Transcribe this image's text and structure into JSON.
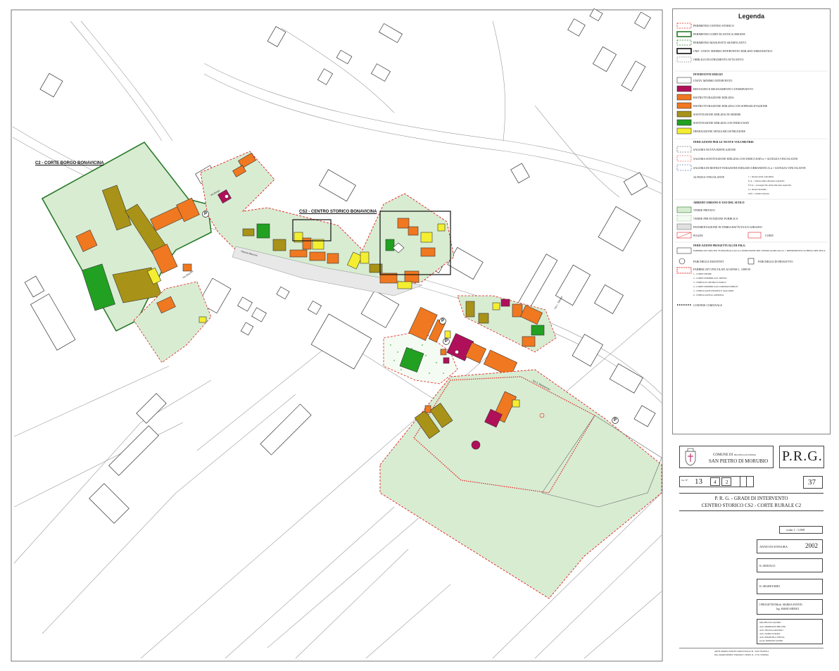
{
  "map": {
    "labels": {
      "c2": "C2 - CORTE BORGO BONAVICINA",
      "cs2": "CS2 - CENTRO STORICO BONAVICINA"
    },
    "streets": [
      "Via Borgo",
      "Piazza Marconi",
      "Via Mazzini",
      "Via S. Bartolomeo",
      "Via L. Stefani"
    ],
    "parking_symbol": "P",
    "colors": {
      "verde_privato": "#d8ecd2",
      "restauro": "#b0105a",
      "ristrutturazione": "#f07820",
      "sostituzione_sedime": "#a89218",
      "sostituzione_dati": "#22a022",
      "demolizione": "#f4ee30",
      "perimetro": "#e02020",
      "corti": "#2a7a2a",
      "piazze": "#e8e8e8"
    }
  },
  "legend": {
    "title": "Legenda",
    "perimeters": [
      "PERIMETRO CENTRO STORICO",
      "PERIMETRO CORTI DI ANTICA ORIGINE",
      "PERIMETRO MANUFATTI SIGNIFICATIVI",
      "UMI - UNITA' MINIMO INTERVENTO EDILIZIO URBANISTICO",
      "OBBLIGO DI STRUMENTO ATTUATIVO"
    ],
    "interventi_title": "INTERVENTI EDILIZI",
    "interventi": [
      "UNITA' MINIMO INTERVENTO",
      "RESTAURO E RISANAMENTO CONSERVATIVO",
      "RISTRUTTURAZIONE EDILIZIA",
      "RISTRUTTURAZIONE EDILIZIA CON SOPRAELEVAZIONE",
      "SOSTITUZIONE EDILIZIA IN SEDIME",
      "SOSTITUZIONE EDILIZIA CON INDICI DATI",
      "DEMOLIZIONE SENZA RICOSTRUZIONE"
    ],
    "volumetrie_title": "INDICAZIONI PER LE NUOVE VOLUMETRIE",
    "volumetrie": [
      "SAGOMA NUOVA EDIFICAZIONE",
      "SAGOMA SOSTITUZIONE EDILIZIA CON INDICI DATI n = ALTEZZA VINCOLANTE",
      "SAGOMA DI RISTRUTTURAZIONE EDILIZIO URBANISTICA n = ALTEZZA VINCOLANTE",
      "ALTEZZA VINCOLANTE"
    ],
    "altezza_notes": [
      "1 = altezza unità contermine",
      "U.A. = altezza unità adiacente regolarità",
      "P.T.A. = prosegue filo unità adiacente regolarità",
      "n = altezza massima",
      "0.90 = volume interrato"
    ],
    "arredo_title": "ARREDO URBANO E USO DEL SUOLO",
    "arredo": [
      "VERDE PRIVATO",
      "VERDE PER FUNZIONE PUBBLICA",
      "PAVIMENTAZIONE IN TERRA BATTUTA E/O GHIAINO",
      "PIAZZE",
      "CORTI"
    ],
    "progettuali_title": "INDICAZIONI PROGETTUALI DI P.R.G.",
    "progettuali": [
      "FABBRICATI NON PIU' FUNZIONALI ALLA CONDUZIONE DEL FONDO AGRICOLO n = RIFERIMENTO SCHEDA SPECIFICA",
      "PARCHEGGI ESISTENTI",
      "PARCHEGGI DI PROGETTO"
    ],
    "vincolati_title": "FABBRICATI VINCOLATI AI SENSI L. 1089/39",
    "vincolati": [
      "1 - CORTE DENDE",
      "2 - CORTE DOMINICALE 'ODETA'",
      "3 - CHIESA SS. PIETRO E PAOLO",
      "4 - CORTE DOMINICALE LOREDAN-EMILEI",
      "5 - CHIESA SANTI FILIPPO E GIACOMO",
      "6 - CHIESA SANTA CATERINA"
    ],
    "confine": "CONFINE COMUNALE"
  },
  "title_block": {
    "comune_di": "COMUNE DI",
    "provincia": "PROVINCIA DI VERONA",
    "comune": "SAN PIETRO DI MORUBIO",
    "prg": "P.R.G.",
    "tav_label": "tav. N°",
    "tav_numbers": [
      "13",
      "4",
      "2"
    ],
    "sheet": "37",
    "subject_line1": "P. R. G.  -  GRADI DI INTERVENTO",
    "subject_line2": "CENTRO STORICO CS2 - CORTE RURALE C2",
    "scale": "scala  1 : 1.000",
    "anno_label": "ANNO DI STESURA",
    "anno": "2002",
    "sindaco": "IL SINDACO",
    "segretario": "IL SEGRETARIO",
    "progettisti_label": "I PROGETTISTI",
    "progettisti": [
      "Arch.  MARISA FANTIN",
      "Ing.   MARIO MEDICI"
    ],
    "gruppo_title": "GRUPPO DI LAVORO",
    "gruppo": [
      "Arch.  ARMIDANO BELLERI",
      "Arch.  NICOLA GRAZIOLI",
      "Arch.  NADIA TURATA",
      "Arch.  EMANUELA STELTA",
      "Geom.  FABIANO ZANINI"
    ],
    "footer1": "ARCH. MARISA FANTIN      CORSO ITALIA 139 - SAN VEGNOLA",
    "footer2": "ING. MARIO MEDICI        VERSANO S. BONO 14 - 37121 VERONA"
  }
}
